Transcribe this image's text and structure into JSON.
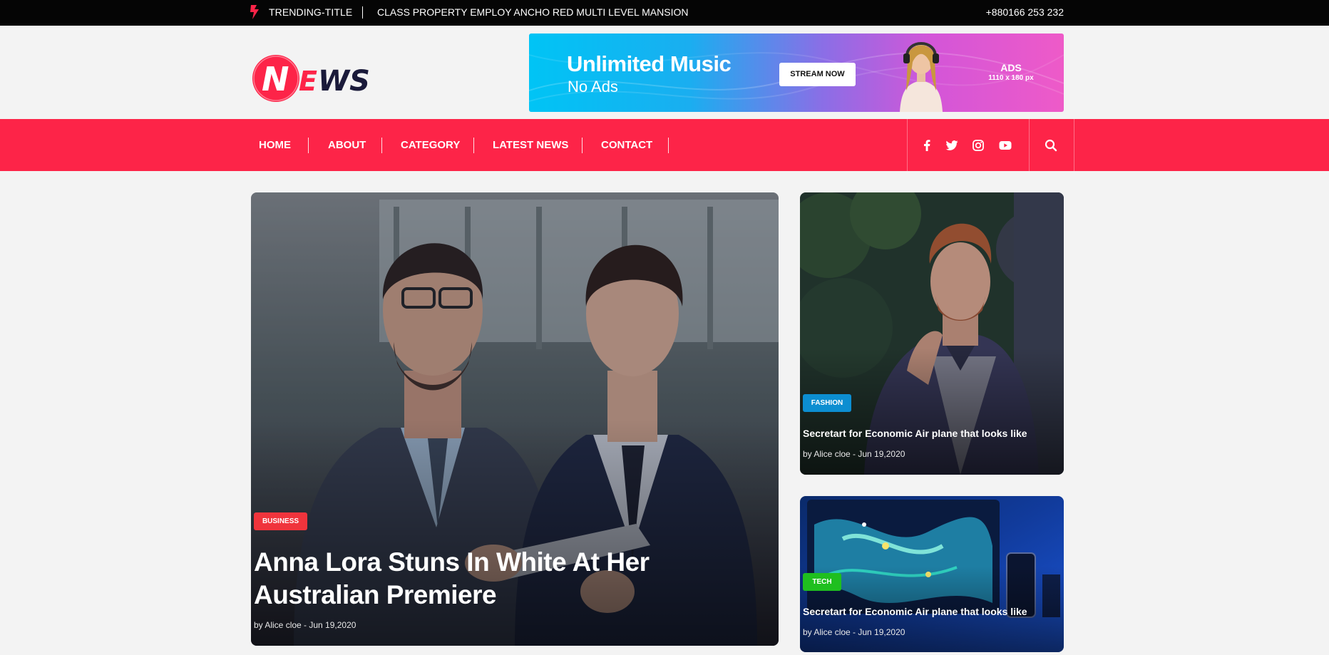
{
  "topbar": {
    "trending_label": "TRENDING-TITLE",
    "headline": "CLASS PROPERTY EMPLOY ANCHO RED MULTI LEVEL MANSION",
    "phone": "+880166 253 232"
  },
  "logo": {
    "text_n": "N",
    "text_e": "E",
    "text_ws": "WS"
  },
  "ad": {
    "title": "Unlimited Music",
    "subtitle": "No Ads",
    "button": "STREAM NOW",
    "label": "ADS",
    "size": "1110 x 180 px"
  },
  "nav": {
    "items": [
      "HOME",
      "ABOUT",
      "CATEGORY",
      "LATEST NEWS",
      "CONTACT"
    ],
    "social_icons": [
      "facebook-icon",
      "twitter-icon",
      "instagram-icon",
      "youtube-icon"
    ],
    "search_icon": "search-icon"
  },
  "main_story": {
    "category": "BUSINESS",
    "title_line1": "Anna Lora Stuns In White At Her",
    "title_line2": "Australian Premiere",
    "meta": "by Alice cloe - Jun 19,2020"
  },
  "side_stories": [
    {
      "category": "FASHION",
      "title": "Secretart for Economic Air plane that looks like",
      "meta": "by Alice cloe - Jun 19,2020"
    },
    {
      "category": "TECH",
      "title": "Secretart for Economic Air plane that looks like",
      "meta": "by Alice cloe - Jun 19,2020"
    }
  ],
  "colors": {
    "brand_red": "#fd2448",
    "business_badge": "#f0343c",
    "fashion_badge": "#0c8ed1",
    "tech_badge": "#1fbf1f"
  }
}
